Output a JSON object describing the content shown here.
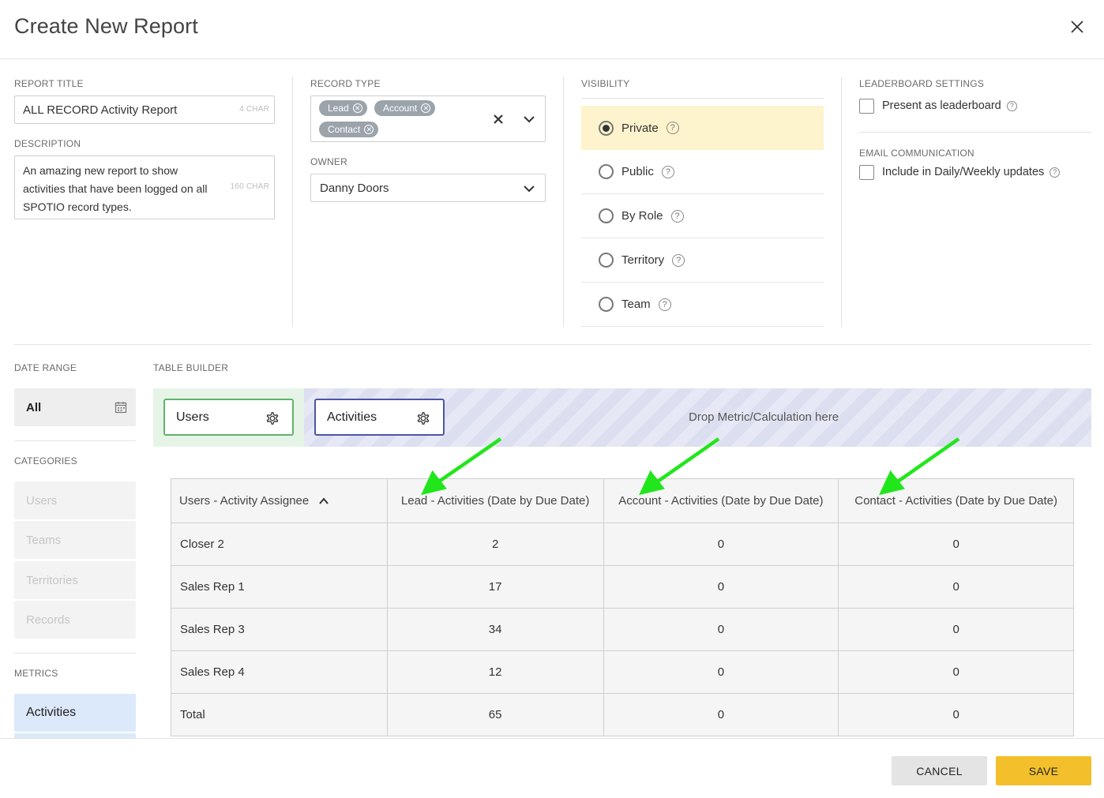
{
  "dialog": {
    "title": "Create New Report"
  },
  "report_title": {
    "label": "REPORT TITLE",
    "value": "ALL RECORD Activity Report",
    "char_count": "4 CHAR"
  },
  "description": {
    "label": "DESCRIPTION",
    "lines": [
      "An amazing new report to show",
      "activities that have been logged on all",
      "SPOTIO record types."
    ],
    "char_count": "160 CHAR"
  },
  "record_type": {
    "label": "RECORD TYPE",
    "chips": [
      "Lead",
      "Account",
      "Contact"
    ]
  },
  "owner": {
    "label": "OWNER",
    "value": "Danny Doors"
  },
  "visibility": {
    "label": "VISIBILITY",
    "options": [
      "Private",
      "Public",
      "By Role",
      "Territory",
      "Team"
    ],
    "selected": "Private"
  },
  "leaderboard": {
    "label": "LEADERBOARD SETTINGS",
    "checkbox_label": "Present as leaderboard"
  },
  "email": {
    "label": "EMAIL COMMUNICATION",
    "checkbox_label": "Include in Daily/Weekly updates"
  },
  "date_range": {
    "label": "DATE RANGE",
    "value": "All"
  },
  "categories": {
    "label": "CATEGORIES",
    "items": [
      "Users",
      "Teams",
      "Territories",
      "Records"
    ]
  },
  "metrics": {
    "label": "METRICS",
    "items": [
      "Activities"
    ]
  },
  "table_builder": {
    "label": "TABLE BUILDER",
    "pills": [
      "Users",
      "Activities"
    ],
    "drop_text": "Drop Metric/Calculation here"
  },
  "table": {
    "headers": [
      "Users - Activity Assignee",
      "Lead - Activities (Date by Due Date)",
      "Account - Activities (Date by Due Date)",
      "Contact - Activities (Date by Due Date)"
    ],
    "rows": [
      [
        "Closer 2",
        "2",
        "0",
        "0"
      ],
      [
        "Sales Rep 1",
        "17",
        "0",
        "0"
      ],
      [
        "Sales Rep 3",
        "34",
        "0",
        "0"
      ],
      [
        "Sales Rep 4",
        "12",
        "0",
        "0"
      ],
      [
        "Total",
        "65",
        "0",
        "0"
      ]
    ]
  },
  "footer": {
    "cancel_label": "CANCEL",
    "save_label": "SAVE"
  },
  "colors": {
    "save": "#f3c02b",
    "cancel": "#e4e4e4",
    "arrow": "#22e61c",
    "selected_row": "#fdf3cc",
    "metric_active": "#dce9fb"
  }
}
